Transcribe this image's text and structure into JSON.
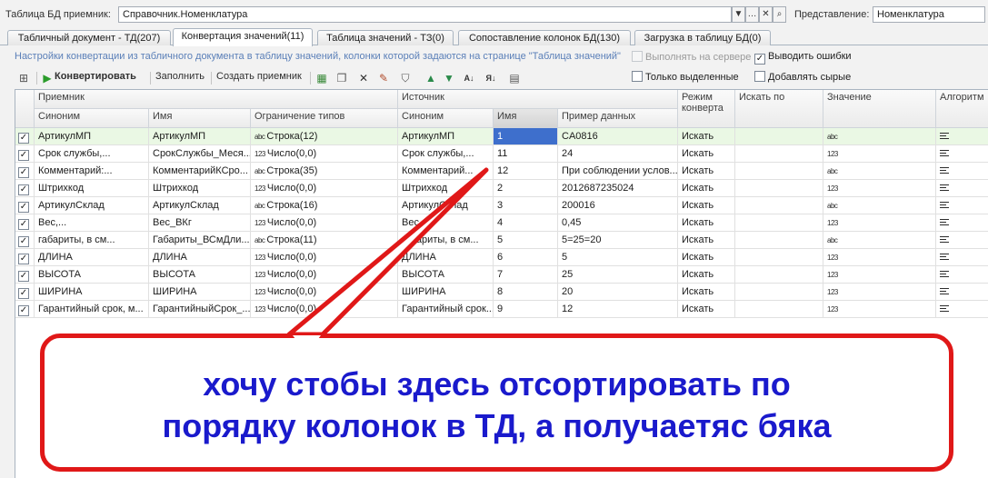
{
  "top": {
    "table_label": "Таблица БД приемник:",
    "table_value": "Справочник.Номенклатура",
    "view_label": "Представление:",
    "view_value": "Номенклатура"
  },
  "tabs": [
    {
      "label": "Табличный документ - ТД(207)"
    },
    {
      "label": "Конвертация значений(11)"
    },
    {
      "label": "Таблица значений - ТЗ(0)"
    },
    {
      "label": "Сопоставление колонок БД(130)"
    },
    {
      "label": "Загрузка в таблицу БД(0)"
    }
  ],
  "hint": "Настройки конвертации из табличного документа в таблицу значений, колонки которой задаются на странице \"Таблица значений\"",
  "options": {
    "server": "Выполнять на сервере",
    "errors": "Выводить ошибки",
    "selected_only": "Только выделенные",
    "add_raw": "Добавлять сырые"
  },
  "toolbar": {
    "convert": "Конвертировать",
    "fill": "Заполнить",
    "create_receiver": "Создать приемник"
  },
  "headers": {
    "receiver": "Приемник",
    "source": "Источник",
    "mode": "Режим конверта",
    "search_in": "Искать по",
    "value": "Значение",
    "algorithm": "Алгоритм",
    "synonym": "Синоним",
    "name": "Имя",
    "type_limit": "Ограничение типов",
    "src_synonym": "Синоним",
    "src_name": "Имя",
    "example": "Пример данных"
  },
  "rows": [
    {
      "synonym": "АртикулМП",
      "name": "АртикулМП",
      "type_icon": "abc",
      "type": "Строка(12)",
      "src_synonym": "АртикулМП",
      "src_name": "1",
      "example": "CA0816",
      "mode": "Искать",
      "value_icon": "abc"
    },
    {
      "synonym": "Срок службы,...",
      "name": "СрокСлужбы_Меся...",
      "type_icon": "123",
      "type": "Число(0,0)",
      "src_synonym": "Срок службы,...",
      "src_name": "11",
      "example": "24",
      "mode": "Искать",
      "value_icon": "123"
    },
    {
      "synonym": "Комментарий:...",
      "name": "КомментарийКСро...",
      "type_icon": "abc",
      "type": "Строка(35)",
      "src_synonym": "Комментарий...",
      "src_name": "12",
      "example": "При соблюдении услов...",
      "mode": "Искать",
      "value_icon": "abc"
    },
    {
      "synonym": "Штрихкод",
      "name": "Штрихкод",
      "type_icon": "123",
      "type": "Число(0,0)",
      "src_synonym": "Штрихкод",
      "src_name": "2",
      "example": "2012687235024",
      "mode": "Искать",
      "value_icon": "123"
    },
    {
      "synonym": "АртикулСклад",
      "name": "АртикулСклад",
      "type_icon": "abc",
      "type": "Строка(16)",
      "src_synonym": "АртикулСклад",
      "src_name": "3",
      "example": "200016",
      "mode": "Искать",
      "value_icon": "abc"
    },
    {
      "synonym": "Вес,...",
      "name": "Вес_ВКг",
      "type_icon": "123",
      "type": "Число(0,0)",
      "src_synonym": "Вес,...",
      "src_name": "4",
      "example": "0,45",
      "mode": "Искать",
      "value_icon": "123"
    },
    {
      "synonym": "габариты, в см...",
      "name": "Габариты_ВСмДли...",
      "type_icon": "abc",
      "type": "Строка(11)",
      "src_synonym": "габариты, в см...",
      "src_name": "5",
      "example": "5=25=20",
      "mode": "Искать",
      "value_icon": "abc"
    },
    {
      "synonym": "ДЛИНА",
      "name": "ДЛИНА",
      "type_icon": "123",
      "type": "Число(0,0)",
      "src_synonym": "ДЛИНА",
      "src_name": "6",
      "example": "5",
      "mode": "Искать",
      "value_icon": "123"
    },
    {
      "synonym": "ВЫСОТА",
      "name": "ВЫСОТА",
      "type_icon": "123",
      "type": "Число(0,0)",
      "src_synonym": "ВЫСОТА",
      "src_name": "7",
      "example": "25",
      "mode": "Искать",
      "value_icon": "123"
    },
    {
      "synonym": "ШИРИНА",
      "name": "ШИРИНА",
      "type_icon": "123",
      "type": "Число(0,0)",
      "src_synonym": "ШИРИНА",
      "src_name": "8",
      "example": "20",
      "mode": "Искать",
      "value_icon": "123"
    },
    {
      "synonym": "Гарантийный срок, м...",
      "name": "ГарантийныйСрок_...",
      "type_icon": "123",
      "type": "Число(0,0)",
      "src_synonym": "Гарантийный срок...",
      "src_name": "9",
      "example": "12",
      "mode": "Искать",
      "value_icon": "123"
    }
  ],
  "callout": {
    "line1": "хочу стобы здесь отсортировать по",
    "line2": "порядку колонок в ТД, а получаетяс бяка"
  },
  "colors": {
    "accent_red": "#e01818",
    "callout_text": "#1a1acc",
    "row_selected": "#eaf8e4",
    "cell_focus": "#3e6fcc"
  }
}
